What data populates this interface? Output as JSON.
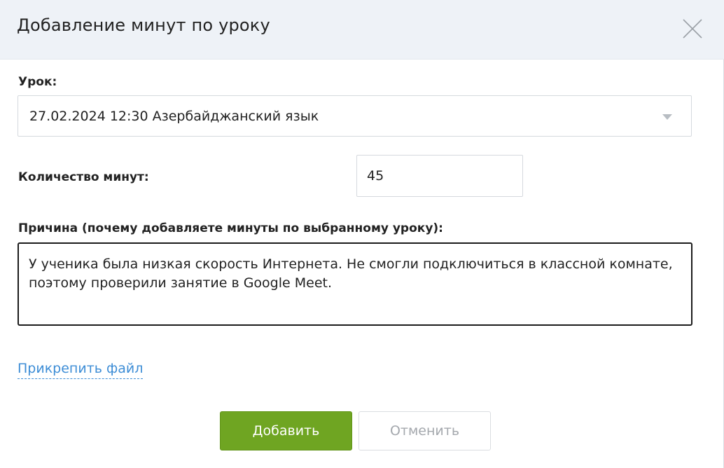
{
  "dialog": {
    "title": "Добавление минут по уроку",
    "close_icon": "close-icon"
  },
  "lesson": {
    "label": "Урок:",
    "selected_value": "27.02.2024 12:30 Азербайджанский язык",
    "arrow_icon": "caret-down-icon"
  },
  "minutes": {
    "label": "Количество минут:",
    "value": "45"
  },
  "reason": {
    "label": "Причина (почему добавляете минуты по выбранному уроку):",
    "value": "У ученика была низкая скорость Интернета. Не смогли подключиться в классной комнате, поэтому проверили занятие в Google Meet."
  },
  "attach": {
    "label": "Прикрепить файл"
  },
  "buttons": {
    "add_label": "Добавить",
    "cancel_label": "Отменить"
  },
  "colors": {
    "header_bg": "#eef2f7",
    "add_button": "#6fa522",
    "link": "#3d8dd6"
  }
}
